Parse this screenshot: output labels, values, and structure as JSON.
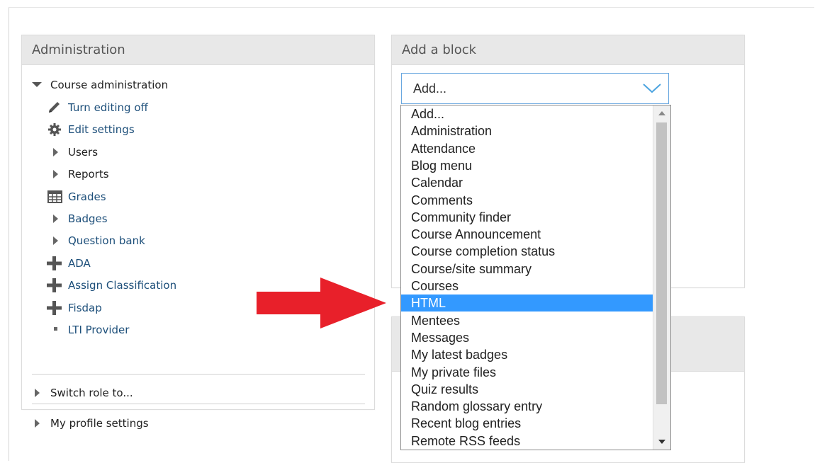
{
  "admin_block": {
    "title": "Administration",
    "course_admin": "Course administration",
    "items": [
      {
        "label": "Turn editing off",
        "icon": "pencil-icon"
      },
      {
        "label": "Edit settings",
        "icon": "gear-icon"
      },
      {
        "label": "Users",
        "icon": "expand-triangle-icon"
      },
      {
        "label": "Reports",
        "icon": "expand-triangle-icon"
      },
      {
        "label": "Grades",
        "icon": "grades-table-icon"
      },
      {
        "label": "Badges",
        "icon": "expand-triangle-icon"
      },
      {
        "label": "Question bank",
        "icon": "expand-triangle-icon"
      },
      {
        "label": "ADA",
        "icon": "plus-icon"
      },
      {
        "label": "Assign Classification",
        "icon": "plus-icon"
      },
      {
        "label": "Fisdap",
        "icon": "plus-icon"
      },
      {
        "label": "LTI Provider",
        "icon": "bullet-icon"
      }
    ],
    "switch_role": "Switch role to...",
    "profile_settings": "My profile settings"
  },
  "add_block": {
    "title": "Add a block",
    "selected_value": "Add...",
    "options": [
      "Add...",
      "Administration",
      "Attendance",
      "Blog menu",
      "Calendar",
      "Comments",
      "Community finder",
      "Course Announcement",
      "Course completion status",
      "Course/site summary",
      "Courses",
      "HTML",
      "Mentees",
      "Messages",
      "My latest badges",
      "My private files",
      "Quiz results",
      "Random glossary entry",
      "Recent blog entries",
      "Remote RSS feeds"
    ],
    "highlighted_option": "HTML"
  },
  "colors": {
    "link": "#1d4f7a",
    "highlight": "#3399ff",
    "arrow": "#e8202a",
    "header_bg": "#e8e8e8"
  }
}
